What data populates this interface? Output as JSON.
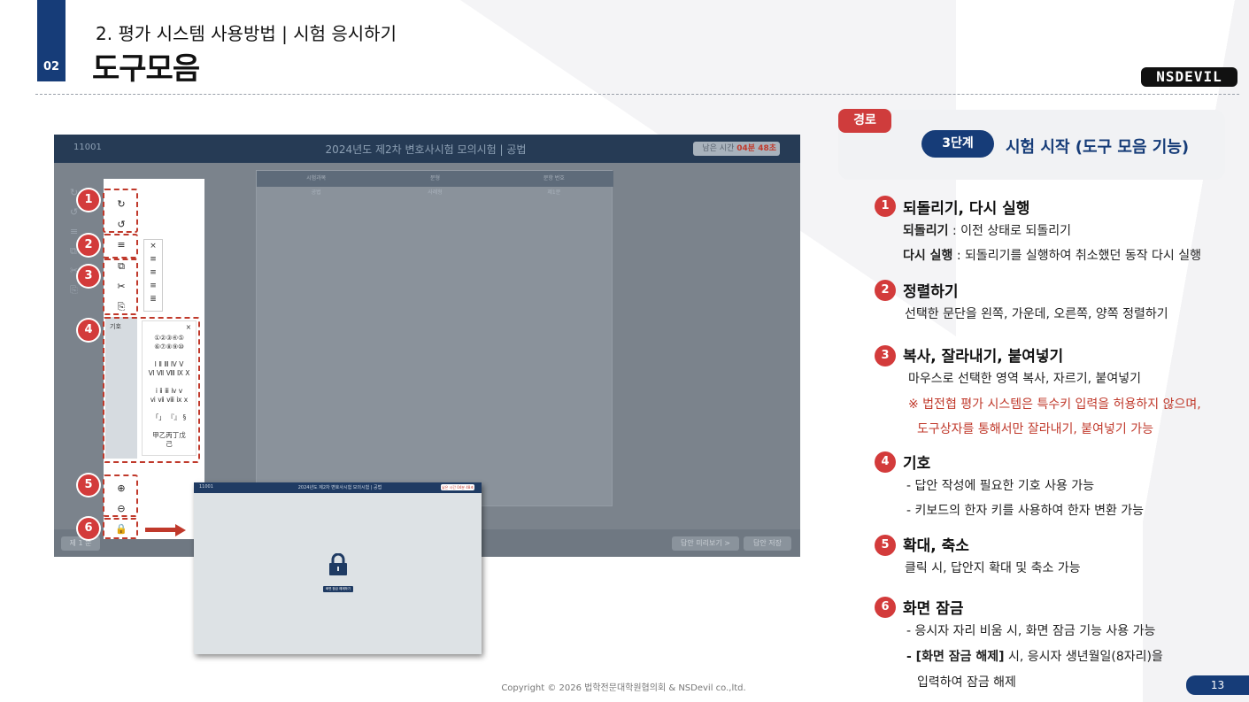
{
  "header": {
    "section_number": "02",
    "subtitle": "2. 평가 시스템 사용방법 | 시험 응시하기",
    "title": "도구모음",
    "logo_text": "NSDEVIL"
  },
  "screenshot": {
    "exam_id": "11001",
    "exam_title": "2024년도 제2차 변호사시험 모의시험 | 공법",
    "timer_label": "남은 시간",
    "timer_value": "04분 48초",
    "table_headers": [
      "시험과목",
      "문형",
      "문항 번호"
    ],
    "table_row": [
      "공법",
      "사례형",
      "제1문"
    ],
    "bottom_left": "제 1 문",
    "bottom_buttons": [
      "답안 미리보기 >",
      "답안 저장"
    ]
  },
  "toolbox": {
    "symbol_label": "기호",
    "align_close": "×",
    "symbol_close": "×",
    "symbol_rows": [
      "①②③④⑤",
      "⑥⑦⑧⑨⑩",
      "Ⅰ Ⅱ Ⅲ Ⅳ Ⅴ",
      "Ⅵ Ⅶ Ⅷ Ⅸ Ⅹ",
      "ⅰ ⅱ ⅲ ⅳ ⅴ",
      "ⅵ ⅶ ⅷ ⅸ ⅹ",
      "「」 『』 §",
      "甲乙丙丁戊",
      "己"
    ],
    "badges": [
      "1",
      "2",
      "3",
      "4",
      "5",
      "6"
    ]
  },
  "lock_screen": {
    "exam_id": "11001",
    "exam_title": "2024년도 제2차 변호사시험 모의시험 | 공법",
    "timer": "남은 시간 04분 48초",
    "unlock_button": "화면 잠금 해제하기"
  },
  "route": {
    "tag": "경로",
    "step": "3단계",
    "title": "시험 시작 (도구 모음 기능)"
  },
  "items": [
    {
      "num": "1",
      "title": "되돌리기, 다시 실행",
      "l1_bold": "되돌리기",
      "l1": " : 이전 상태로 되돌리기",
      "l2_bold": "다시 실행",
      "l2": " : 되돌리기를 실행하여 취소했던 동작 다시 실행"
    },
    {
      "num": "2",
      "title": "정렬하기",
      "l1": "선택한 문단을 왼쪽, 가운데, 오른쪽, 양쪽 정렬하기"
    },
    {
      "num": "3",
      "title": "복사, 잘라내기, 붙여넣기",
      "l1": "마우스로 선택한 영역 복사, 자르기, 붙여넣기",
      "l2": "※ 법전협 평가 시스템은 특수키 입력을 허용하지 않으며,",
      "l3": "도구상자를 통해서만 잘라내기, 붙여넣기 가능"
    },
    {
      "num": "4",
      "title": "기호",
      "l1": "- 답안 작성에 필요한 기호 사용 가능",
      "l2": "- 키보드의 한자 키를 사용하여 한자 변환 가능"
    },
    {
      "num": "5",
      "title": "확대, 축소",
      "l1": "클릭 시, 답안지 확대 및 축소 가능"
    },
    {
      "num": "6",
      "title": "화면 잠금",
      "l1": "- 응시자 자리 비움 시, 화면 잠금 기능 사용 가능",
      "l2_bold": "- [화면 잠금 해제]",
      "l2": " 시, 응시자 생년월일(8자리)을",
      "l3": "입력하여 잠금 해제"
    }
  ],
  "footer": {
    "copyright": "Copyright © 2026 법학전문대학원협의회 & NSDevil co.,ltd.",
    "page_number": "13"
  },
  "colors": {
    "navy": "#163c78",
    "red": "#cf3c3c"
  }
}
